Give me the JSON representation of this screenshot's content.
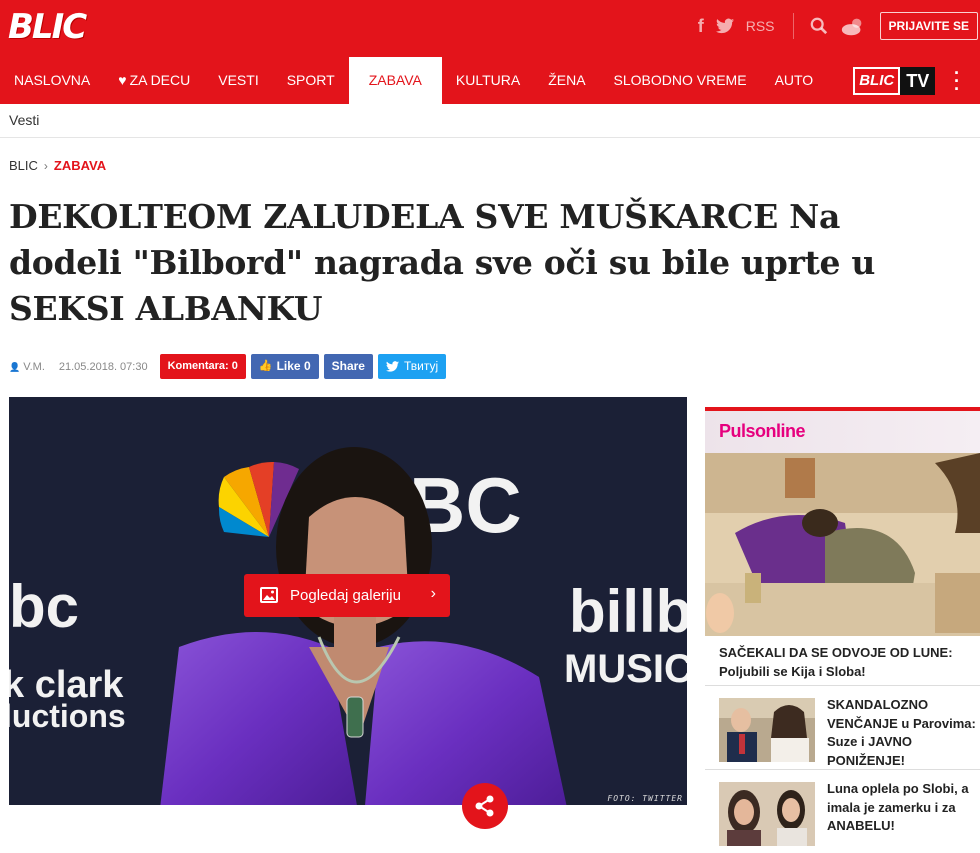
{
  "header": {
    "logo": "BLIC",
    "rss": "RSS",
    "login": "PRIJAVITE SE"
  },
  "nav": {
    "items": [
      "NASLOVNA",
      "ZA DECU",
      "VESTI",
      "SPORT",
      "ZABAVA",
      "KULTURA",
      "ŽENA",
      "SLOBODNO VREME",
      "AUTO"
    ],
    "active": "ZABAVA",
    "tv_logo": "BLIC",
    "tv_label": "TV"
  },
  "subbar": {
    "label": "Vesti"
  },
  "breadcrumb": {
    "home": "BLIC",
    "section": "ZABAVA"
  },
  "article": {
    "title": "DEKOLTEOM ZALUDELA SVE MUŠKARCE Na dodeli \"Bilbord\" nagrada sve oči su bile uprte u SEKSI ALBANKU",
    "author": "V.M.",
    "date": "21.05.2018. 07:30",
    "comments": "Komentara: 0",
    "like": "Like 0",
    "share": "Share",
    "tweet": "Твитуј",
    "gallery_button": "Pogledaj galeriju",
    "photo_credit": "FOTO: TWITTER"
  },
  "sidebar": {
    "brand": "Pulsonline",
    "feature_title": "SAČEKALI DA SE ODVOJE OD LUNE: Poljubili se Kija i Sloba!",
    "items": [
      {
        "title": "SKANDALOZNO VENČANJE u Parovima: Suze i JAVNO PONIŽENJE!"
      },
      {
        "title": "Luna oplela po Slobi, a imala je zamerku i za ANABELU!"
      }
    ]
  },
  "colors": {
    "brand_red": "#e3141b",
    "facebook": "#4267b2",
    "twitter": "#1da1f2",
    "puls_pink": "#e6007e"
  }
}
